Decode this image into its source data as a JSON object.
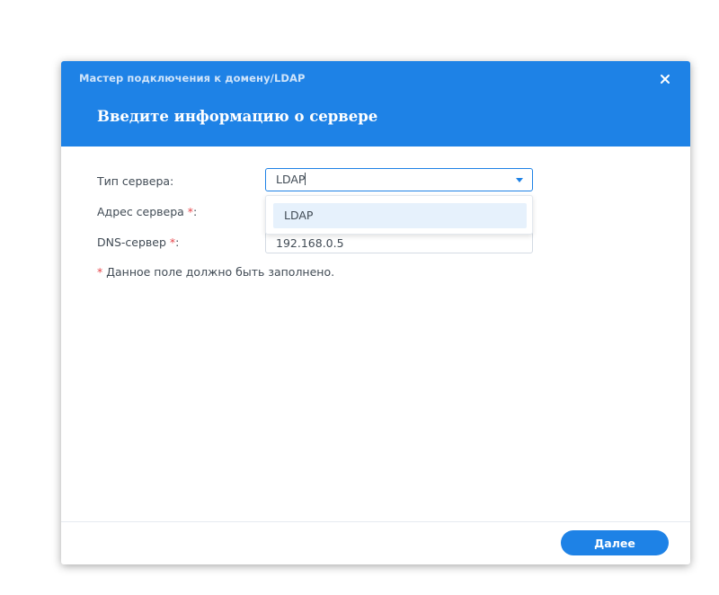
{
  "dialog": {
    "wizard_title": "Мастер подключения к домену/LDAP",
    "step_title": "Введите информацию о сервере",
    "close_icon": "close-icon"
  },
  "form": {
    "server_type": {
      "label": "Тип сервера:",
      "value": "LDAP",
      "options": [
        "LDAP"
      ]
    },
    "server_address": {
      "label": "Адрес сервера ",
      "required_mark": "*",
      "label_suffix": ":",
      "value": ""
    },
    "dns_server": {
      "label": "DNS-сервер ",
      "required_mark": "*",
      "label_suffix": ":",
      "value": "192.168.0.5"
    },
    "required_note": {
      "mark": "*",
      "text": " Данное поле должно быть заполнено."
    }
  },
  "footer": {
    "next_label": "Далее"
  },
  "colors": {
    "header": "#1e82e6",
    "accent": "#1e82e6",
    "required": "#e6464b",
    "highlight": "#e6f1fc"
  }
}
